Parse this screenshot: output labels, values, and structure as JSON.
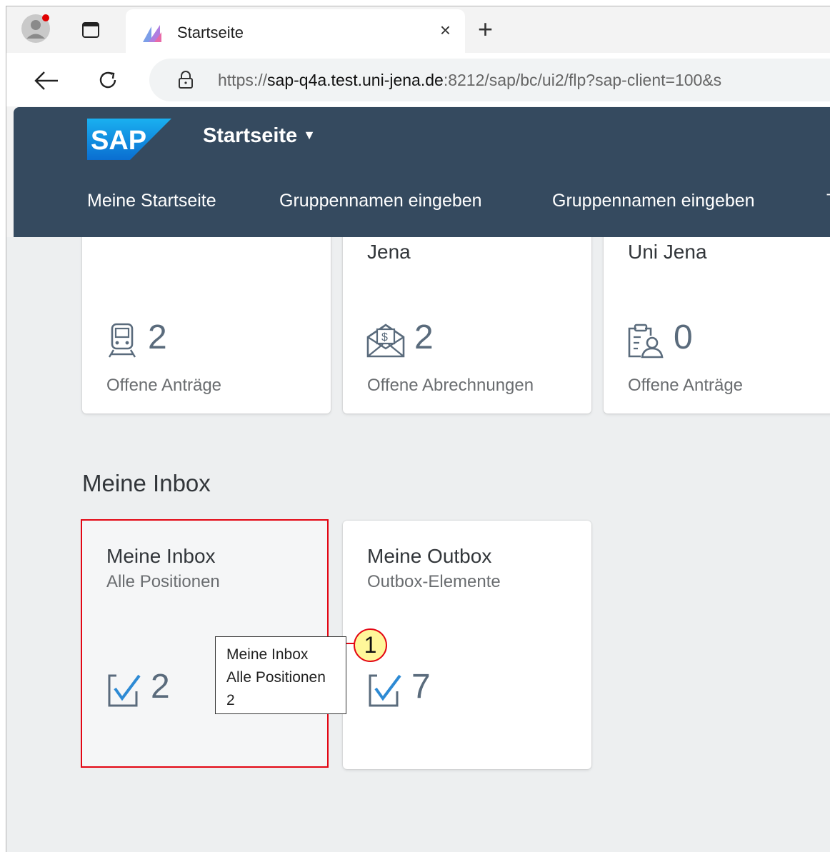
{
  "browser": {
    "tab_title": "Startseite",
    "tab_close": "×",
    "new_tab": "+",
    "url_scheme": "https://",
    "url_host": "sap-q4a.test.uni-jena.de",
    "url_rest": ":8212/sap/bc/ui2/flp?sap-client=100&s",
    "icons": [
      "profile-icon",
      "tab-actions-icon",
      "sap-favicon",
      "back-arrow-icon",
      "reload-icon",
      "lock-icon"
    ]
  },
  "shell": {
    "logo_text": "SAP",
    "title": "Startseite",
    "tabs": [
      "Meine Startseite",
      "Gruppennamen eingeben",
      "Gruppennamen eingeben",
      "T"
    ],
    "colors": {
      "shell_bg": "#354a5f"
    }
  },
  "tiles_top": [
    {
      "title_fragment": "",
      "icon": "train-icon",
      "number": "2",
      "footer": "Offene Anträge"
    },
    {
      "title_fragment": "Jena",
      "icon": "envelope-money-icon",
      "number": "2",
      "footer": "Offene Abrechnungen"
    },
    {
      "title_fragment": "Uni Jena",
      "icon": "clipboard-person-icon",
      "number": "0",
      "footer": "Offene Anträge"
    }
  ],
  "section": {
    "title": "Meine Inbox"
  },
  "tiles_inbox": [
    {
      "title": "Meine Inbox",
      "subtitle": "Alle Positionen",
      "icon": "checkbox-icon",
      "number": "2"
    },
    {
      "title": "Meine Outbox",
      "subtitle": "Outbox-Elemente",
      "icon": "checkbox-icon",
      "number": "7"
    }
  ],
  "tooltip": {
    "lines": [
      "Meine Inbox",
      "Alle Positionen",
      "2"
    ]
  },
  "callout": {
    "number": "1",
    "color": "#e30613"
  }
}
